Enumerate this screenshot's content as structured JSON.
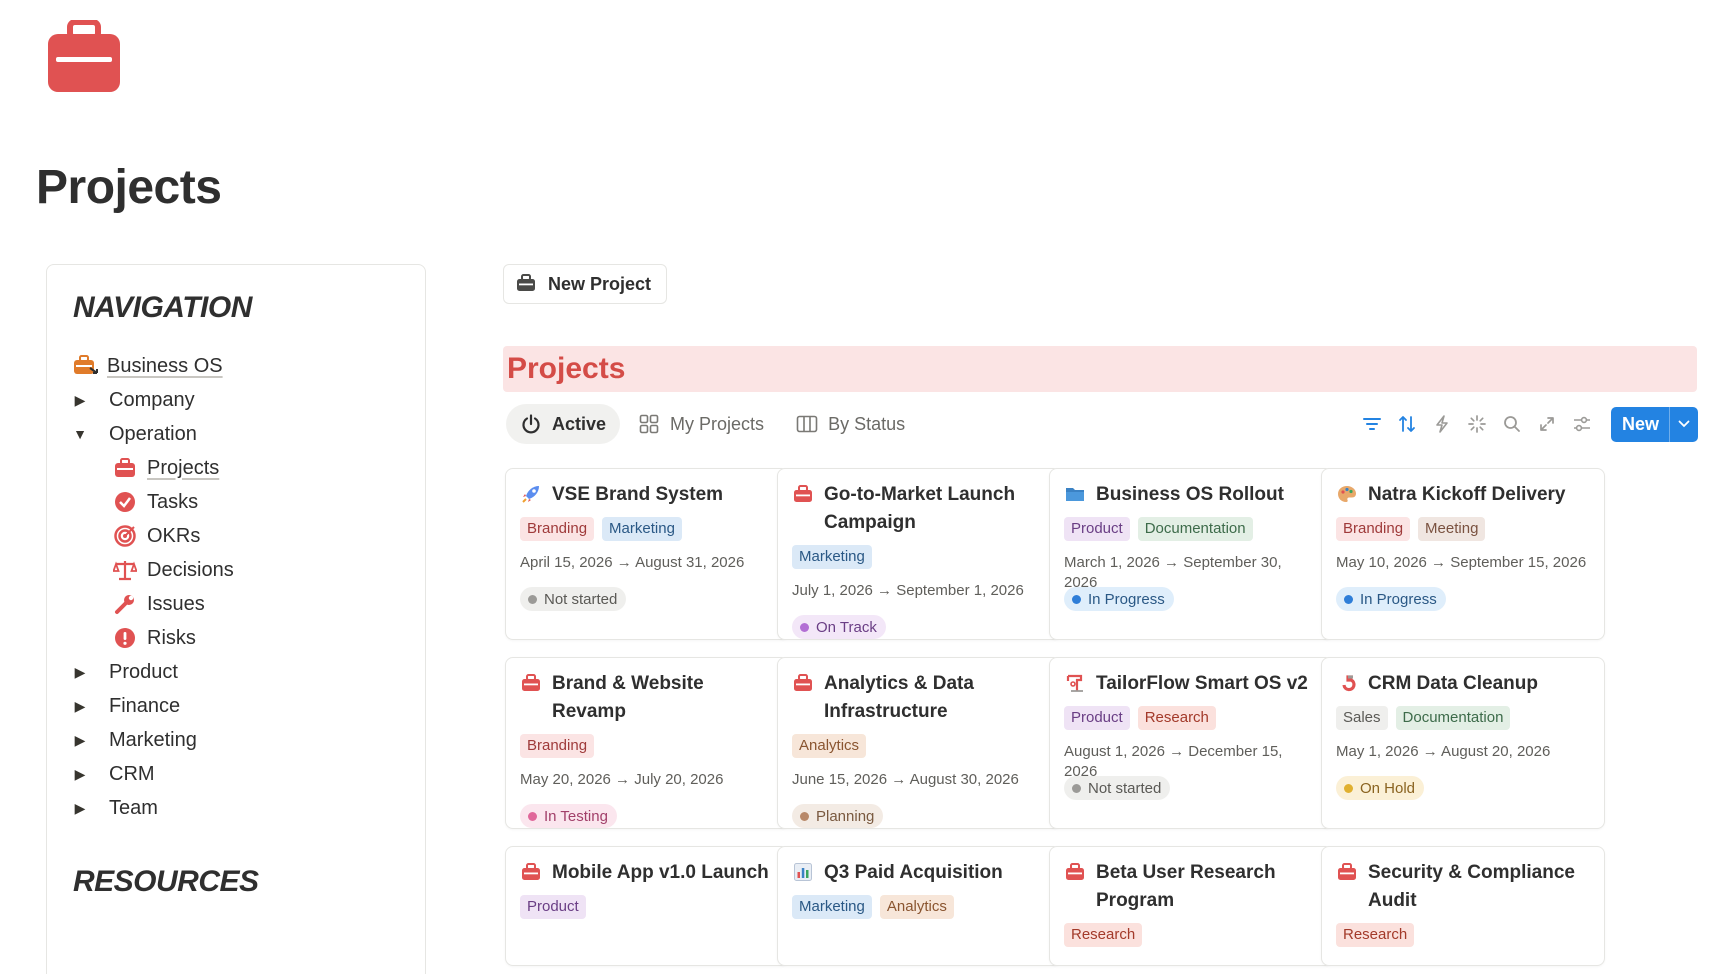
{
  "page": {
    "title": "Projects",
    "icon": "briefcase-icon"
  },
  "navigation": {
    "heading": "NAVIGATION",
    "home": {
      "label": "Business OS",
      "icon": "briefcase-arrow-icon"
    },
    "sections": [
      {
        "label": "Company",
        "expanded": false
      },
      {
        "label": "Operation",
        "expanded": true
      },
      {
        "label": "Product",
        "expanded": false
      },
      {
        "label": "Finance",
        "expanded": false
      },
      {
        "label": "Marketing",
        "expanded": false
      },
      {
        "label": "CRM",
        "expanded": false
      },
      {
        "label": "Team",
        "expanded": false
      }
    ],
    "operation_items": [
      {
        "label": "Projects",
        "icon": "briefcase-icon"
      },
      {
        "label": "Tasks",
        "icon": "check-circle-icon"
      },
      {
        "label": "OKRs",
        "icon": "target-icon"
      },
      {
        "label": "Decisions",
        "icon": "scale-icon"
      },
      {
        "label": "Issues",
        "icon": "wrench-icon"
      },
      {
        "label": "Risks",
        "icon": "alert-circle-icon"
      }
    ],
    "resources_heading": "RESOURCES"
  },
  "main": {
    "new_project_label": "New Project",
    "database_title": "Projects",
    "views": [
      {
        "label": "Active",
        "icon": "power-icon",
        "active": true
      },
      {
        "label": "My Projects",
        "icon": "gallery-icon",
        "active": false
      },
      {
        "label": "By Status",
        "icon": "board-icon",
        "active": false
      }
    ],
    "toolbar": {
      "icons": [
        "filter-icon",
        "sort-icon",
        "automation-icon",
        "ai-sparkle-icon",
        "search-icon",
        "expand-icon",
        "settings-icon"
      ],
      "new_label": "New"
    }
  },
  "colors": {
    "accent": "#2383e2",
    "title_red": "#d44c47",
    "title_bg": "#fbe4e4"
  },
  "tag_styles": {
    "Branding": {
      "bg": "#fbe4e4",
      "fg": "#9f3a3a"
    },
    "Marketing": {
      "bg": "#dbe9f7",
      "fg": "#2a5885"
    },
    "Product": {
      "bg": "#efe3f5",
      "fg": "#6a3e85"
    },
    "Documentation": {
      "bg": "#e3efe5",
      "fg": "#3d6b4a"
    },
    "Meeting": {
      "bg": "#f0e6e1",
      "fg": "#7a5240"
    },
    "Analytics": {
      "bg": "#f7e6d9",
      "fg": "#8a5530"
    },
    "Research": {
      "bg": "#fbe1dd",
      "fg": "#a33a2a"
    },
    "Sales": {
      "bg": "#efefed",
      "fg": "#5a5955"
    }
  },
  "status_styles": {
    "Not started": {
      "bg": "#efefed",
      "fg": "#5a5955",
      "dot": "#9b9a97"
    },
    "On Track": {
      "bg": "#f3e7f8",
      "fg": "#6a3e85",
      "dot": "#b26ed4"
    },
    "In Progress": {
      "bg": "#dfeefb",
      "fg": "#2a5885",
      "dot": "#2f7ed8"
    },
    "In Testing": {
      "bg": "#fbe6ee",
      "fg": "#a2406a",
      "dot": "#e0679a"
    },
    "Planning": {
      "bg": "#f3ebe4",
      "fg": "#7a5a40",
      "dot": "#b8896a"
    },
    "On Hold": {
      "bg": "#fbf0d6",
      "fg": "#8a6320",
      "dot": "#e0b030"
    }
  },
  "projects": [
    {
      "title": "VSE Brand System",
      "icon": "rocket-icon",
      "tags": [
        "Branding",
        "Marketing"
      ],
      "dates": "April 15, 2026 → August 31, 2026",
      "status": "Not started"
    },
    {
      "title": "Go-to-Market Launch Campaign",
      "icon": "briefcase-icon",
      "tags": [
        "Marketing"
      ],
      "dates": "July 1, 2026 → September 1, 2026",
      "status": "On Track"
    },
    {
      "title": "Business OS Rollout",
      "icon": "folder-icon",
      "tags": [
        "Product",
        "Documentation"
      ],
      "dates": "March 1, 2026 → September 30, 2026",
      "status": "In Progress"
    },
    {
      "title": "Natra Kickoff Delivery",
      "icon": "palette-icon",
      "tags": [
        "Branding",
        "Meeting"
      ],
      "dates": "May 10, 2026 → September 15, 2026",
      "status": "In Progress"
    },
    {
      "title": "Brand & Website Revamp",
      "icon": "briefcase-icon",
      "tags": [
        "Branding"
      ],
      "dates": "May 20, 2026 → July 20, 2026",
      "status": "In Testing"
    },
    {
      "title": "Analytics & Data Infrastructure",
      "icon": "briefcase-icon",
      "tags": [
        "Analytics"
      ],
      "dates": "June 15, 2026 → August 30, 2026",
      "status": "Planning"
    },
    {
      "title": "TailorFlow Smart OS v2",
      "icon": "sewing-icon",
      "tags": [
        "Product",
        "Research"
      ],
      "dates": "August 1, 2026 → December 15, 2026",
      "status": "Not started"
    },
    {
      "title": "CRM Data Cleanup",
      "icon": "magnet-icon",
      "tags": [
        "Sales",
        "Documentation"
      ],
      "dates": "May 1, 2026 → August 20, 2026",
      "status": "On Hold"
    },
    {
      "title": "Mobile App v1.0 Launch",
      "icon": "briefcase-icon",
      "tags": [
        "Product"
      ],
      "dates": "",
      "status": ""
    },
    {
      "title": "Q3 Paid Acquisition",
      "icon": "bar-chart-icon",
      "tags": [
        "Marketing",
        "Analytics"
      ],
      "dates": "",
      "status": ""
    },
    {
      "title": "Beta User Research Program",
      "icon": "briefcase-icon",
      "tags": [
        "Research"
      ],
      "dates": "",
      "status": ""
    },
    {
      "title": "Security & Compliance Audit",
      "icon": "briefcase-icon",
      "tags": [
        "Research"
      ],
      "dates": "",
      "status": ""
    }
  ]
}
